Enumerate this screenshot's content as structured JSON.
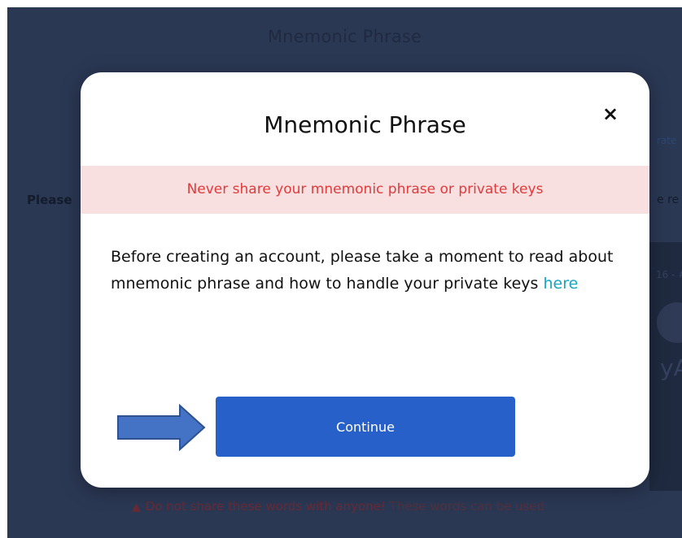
{
  "background": {
    "title": "Mnemonic Phrase",
    "left_text": "Please",
    "right_top_text": "rate",
    "right_mid_text": "e re",
    "panel_text": "16 - #",
    "logo_text": "yA",
    "bottom_warning": "Do not share these words with anyone!",
    "bottom_muted": " These words can be used"
  },
  "modal": {
    "title": "Mnemonic Phrase",
    "close_label": "×",
    "warning": "Never share your mnemonic phrase or private keys",
    "body_text": "Before creating an account, please take a moment to read about mnemonic phrase and how to handle your private keys ",
    "link_text": "here",
    "continue_label": "Continue"
  },
  "annotation": {
    "arrow_color": "#4472c4",
    "arrow_stroke": "#2f528f"
  },
  "colors": {
    "backdrop": "#2b3854",
    "warning_bg": "#f8dfe0",
    "warning_text": "#e03b3b",
    "link": "#16a5c4",
    "button": "#2760c8"
  }
}
